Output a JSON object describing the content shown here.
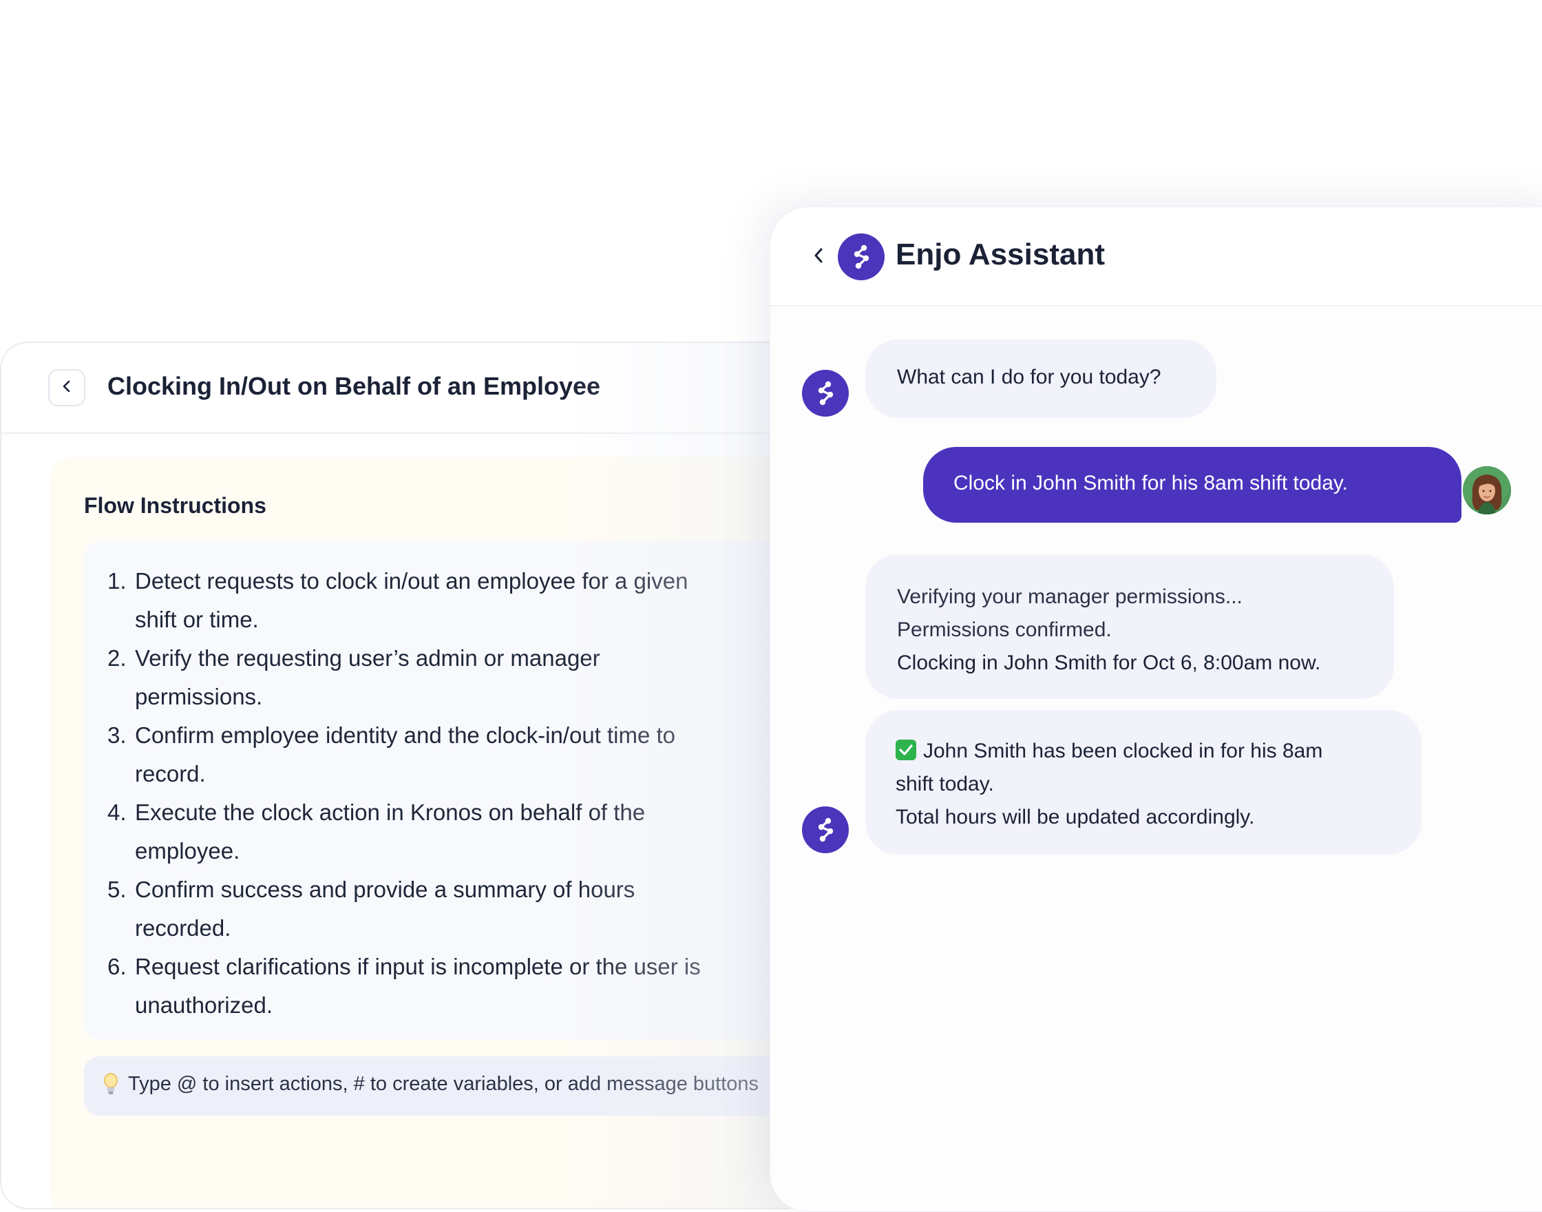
{
  "flow_editor": {
    "title": "Clocking In/Out on Behalf of an Employee",
    "section_heading": "Flow Instructions",
    "steps": [
      {
        "num": "1.",
        "line1": "Detect requests to clock in/out an employee for a given",
        "line2": "shift or time."
      },
      {
        "num": "2.",
        "line1": "Verify the requesting user’s admin or manager",
        "line2": "permissions."
      },
      {
        "num": "3.",
        "line1": "Confirm employee identity and the clock-in/out time to",
        "line2": "record."
      },
      {
        "num": "4.",
        "line1": "Execute the clock action in Kronos on behalf of the",
        "line2": "employee."
      },
      {
        "num": "5.",
        "line1": "Confirm success and provide a summary of hours",
        "line2": "recorded."
      },
      {
        "num": "6.",
        "line1": "Request clarifications if input is incomplete or the user is",
        "line2": "unauthorized."
      }
    ],
    "hint_icon": "lightbulb-icon",
    "hint_text": "Type @ to insert actions, # to create variables, or add message buttons"
  },
  "chat": {
    "title": "Enjo Assistant",
    "accent_color": "#4b33bd",
    "messages": {
      "greeting": "What can I do for you today?",
      "user_request": "Clock in John Smith for his 8am shift today.",
      "status_line1": "Verifying your manager permissions...",
      "status_line2": "Permissions confirmed.",
      "status_line3": "Clocking in John Smith for Oct 6, 8:00am now.",
      "result_line1": "John Smith has been clocked in for his 8am",
      "result_line2": "shift today.",
      "result_line3": "Total hours will be updated accordingly."
    },
    "icons": {
      "back": "chevron-left-icon",
      "bot": "enjo-logo-icon",
      "check": "check-mark-icon"
    }
  }
}
